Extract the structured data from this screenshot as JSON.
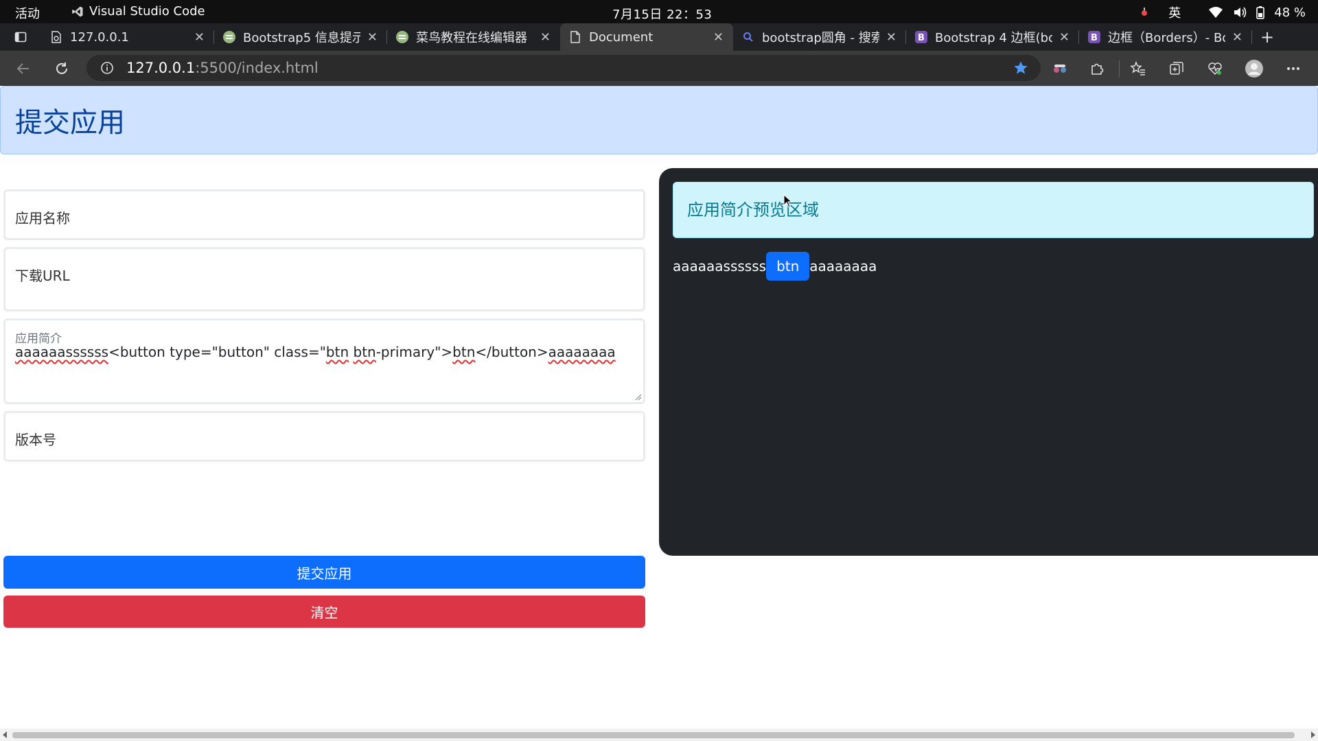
{
  "system_bar": {
    "activities": "活动",
    "app_name": "Visual Studio Code",
    "clock": "7月15日 22：53",
    "input_method": "英",
    "battery": "48 %"
  },
  "browser": {
    "tabs": [
      {
        "title": "127.0.0.1",
        "icon": "page-sync-icon",
        "active": false
      },
      {
        "title": "Bootstrap5 信息提示",
        "icon": "runoob-icon",
        "active": false
      },
      {
        "title": "菜鸟教程在线编辑器",
        "icon": "runoob-icon",
        "active": false
      },
      {
        "title": "Document",
        "icon": "document-icon",
        "active": true
      },
      {
        "title": "bootstrap圆角 - 搜索",
        "icon": "search-icon",
        "active": false
      },
      {
        "title": "Bootstrap 4 边框(bo",
        "icon": "bootstrap-icon",
        "active": false
      },
      {
        "title": "边框（Borders）- Bo",
        "icon": "bootstrap-icon",
        "active": false
      }
    ],
    "url_host": "127.0.0.1",
    "url_path": ":5500/index.html"
  },
  "page": {
    "header_title": "提交应用",
    "form": {
      "app_name_placeholder": "应用名称",
      "download_url_placeholder": "下载URL",
      "intro_label": "应用简介",
      "intro_value_parts": {
        "p1": "aaaaaassssss",
        "p2": "<button type=\"button\" class=\"",
        "p3": "btn",
        "p4": " ",
        "p5": "btn",
        "p6": "-primary\">",
        "p7": "btn",
        "p8": "</button>",
        "p9": "aaaaaaaa"
      },
      "version_placeholder": "版本号",
      "submit_label": "提交应用",
      "clear_label": "清空"
    },
    "preview": {
      "title": "应用简介预览区域",
      "text_before": "aaaaaassssss",
      "button_label": "btn",
      "text_after": "aaaaaaaa"
    }
  },
  "colors": {
    "primary": "#0d6efd",
    "danger": "#dc3545",
    "alert_primary_bg": "#cfe2ff",
    "alert_info_bg": "#cff4fc",
    "dark_bg": "#212529"
  }
}
